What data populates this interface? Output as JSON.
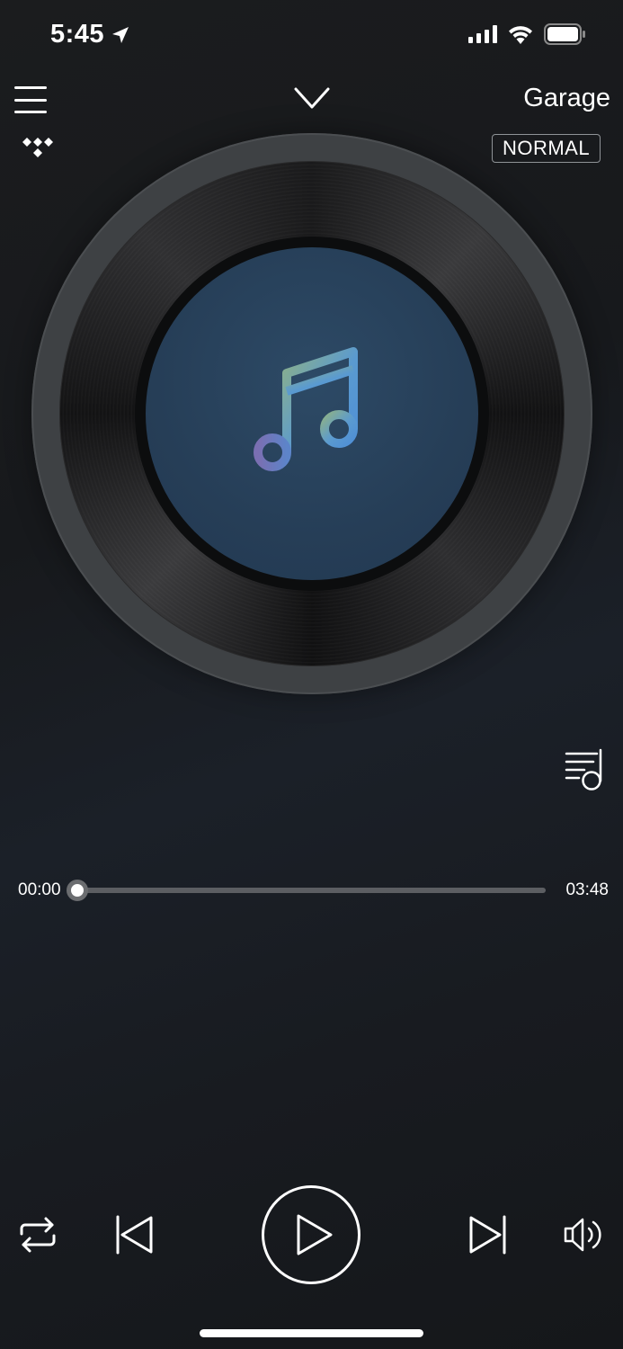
{
  "status_bar": {
    "time": "5:45",
    "icons": [
      "location-arrow-icon",
      "cellular-signal-icon",
      "wifi-icon",
      "battery-icon"
    ]
  },
  "header": {
    "menu_icon": "hamburger-menu-icon",
    "collapse_icon": "chevron-down-icon",
    "device_name": "Garage",
    "source_icon": "tidal-logo",
    "quality_badge": "NORMAL"
  },
  "artwork": {
    "style": "vinyl-record",
    "placeholder_icon": "music-note-icon",
    "label_color": "#263e57"
  },
  "queue_icon": "playlist-queue-icon",
  "progress": {
    "elapsed": "00:00",
    "total": "03:48",
    "fraction": 0.0
  },
  "controls": {
    "repeat_icon": "repeat-icon",
    "previous_icon": "skip-previous-icon",
    "play_icon": "play-icon",
    "next_icon": "skip-next-icon",
    "volume_icon": "volume-icon"
  },
  "colors": {
    "background": "#1a1c20",
    "note_gradient_start": "#8bb08a",
    "note_gradient_end": "#4f8fd6",
    "note_bottom": "#7a6fb2"
  }
}
